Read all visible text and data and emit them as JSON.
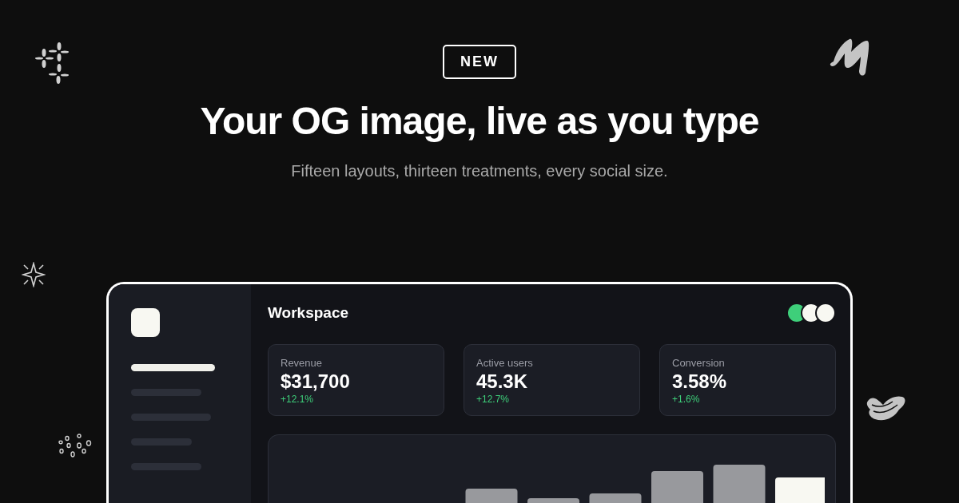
{
  "badge": "NEW",
  "headline": "Your OG image, live as you type",
  "subtitle": "Fifteen layouts, thirteen treatments, every social size.",
  "mockup": {
    "sidebar": {
      "items": [
        {
          "selected": true
        },
        {
          "selected": false
        },
        {
          "selected": false
        },
        {
          "selected": false
        },
        {
          "selected": false
        }
      ]
    },
    "title": "Workspace",
    "avatars": [
      {
        "color": "#3ecf7a"
      },
      {
        "color": "#f8f8f2"
      },
      {
        "color": "#f8f8f2"
      }
    ],
    "stats": [
      {
        "label": "Revenue",
        "value": "$31,700",
        "delta": "+12.1%"
      },
      {
        "label": "Active users",
        "value": "45.3K",
        "delta": "+12.7%"
      },
      {
        "label": "Conversion",
        "value": "3.58%",
        "delta": "+1.6%"
      }
    ]
  }
}
